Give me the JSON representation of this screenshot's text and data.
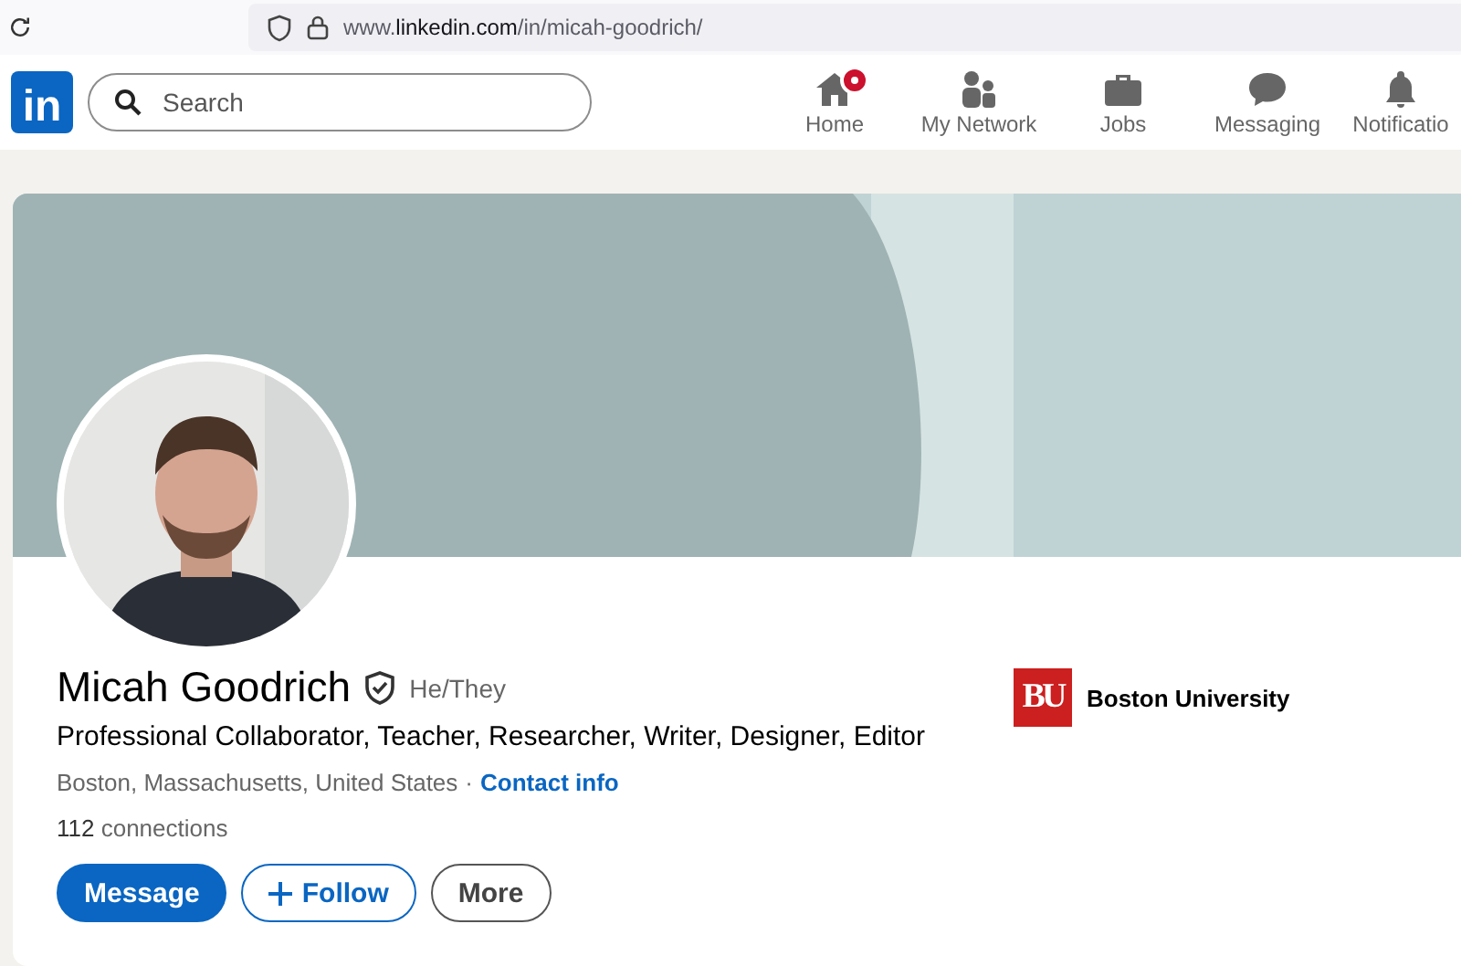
{
  "browser": {
    "url": "www.**linkedin.com**/in/micah-goodrich/"
  },
  "header": {
    "logo": "in",
    "search": {
      "placeholder": "Search"
    },
    "nav": [
      {
        "kind": "home",
        "label": "Home",
        "badge": true
      },
      {
        "kind": "network",
        "label": "My Network",
        "badge": false
      },
      {
        "kind": "jobs",
        "label": "Jobs",
        "badge": false
      },
      {
        "kind": "messaging",
        "label": "Messaging",
        "badge": false
      },
      {
        "kind": "bell",
        "label": "Notificatio",
        "badge": false
      }
    ]
  },
  "profile": {
    "name": "Micah Goodrich",
    "verified": true,
    "pronouns": "He/They",
    "headline": "Professional Collaborator, Teacher, Researcher, Writer, Designer, Editor",
    "location": "Boston, Massachusetts, United States",
    "separator": "·",
    "contact_link": "Contact info",
    "connections": "**112** connections",
    "education": {
      "logo": "BU",
      "name": "Boston University"
    },
    "buttons": [
      {
        "kind": "primary",
        "icon": false,
        "label": "Message"
      },
      {
        "kind": "outline",
        "icon": true,
        "label": "Follow"
      },
      {
        "kind": "secondary",
        "icon": false,
        "label": "More"
      }
    ]
  }
}
